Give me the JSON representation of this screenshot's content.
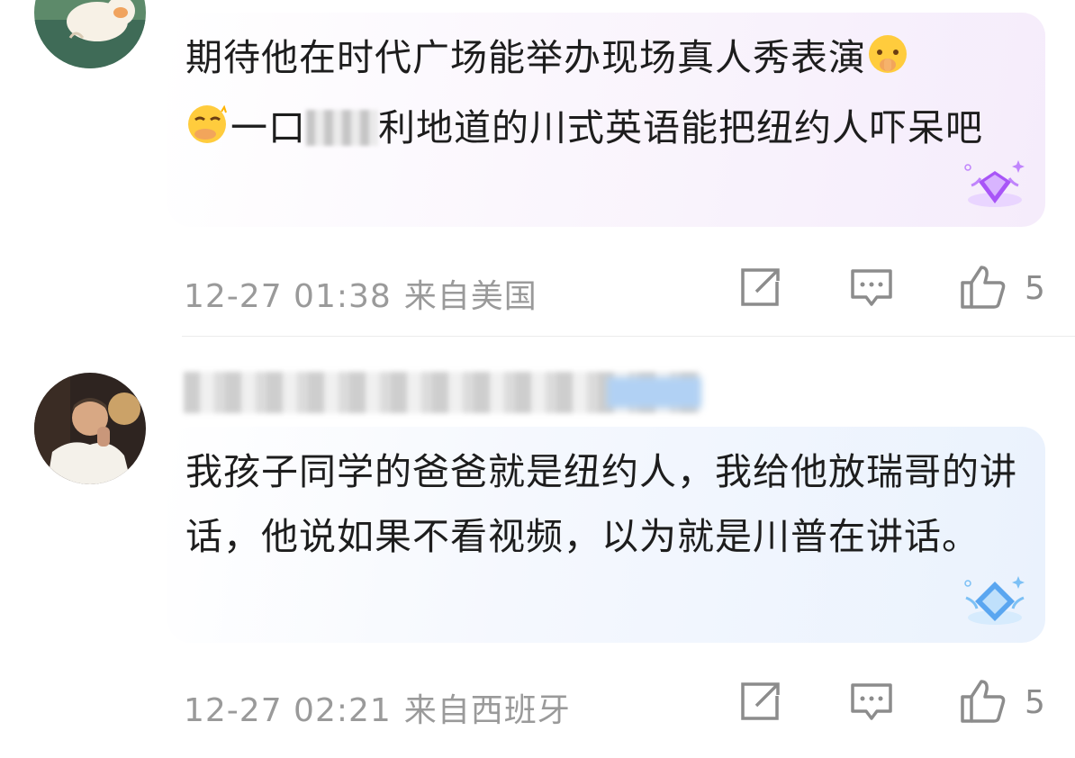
{
  "comments": [
    {
      "avatar_icon": "cat-avatar",
      "text_segments": [
        "期待他在时代广场能举办现场真人秀表演",
        "一口",
        "利地道的川式英语能把纽约人吓呆吧"
      ],
      "emoji_1": "shushing-face-emoji",
      "emoji_2": "smirk-face-emoji",
      "badge_icon": "purple-diamond-badge-icon",
      "time": "12-27 01:38",
      "location": "来自美国",
      "likes": "5"
    },
    {
      "avatar_icon": "person-avatar",
      "text": "我孩子同学的爸爸就是纽约人，我给他放瑞哥的讲话，他说如果不看视频，以为就是川普在讲话。",
      "badge_icon": "blue-diamond-badge-icon",
      "time": "12-27 02:21",
      "location": "来自西班牙",
      "likes": "5"
    }
  ],
  "icons": {
    "share": "share-icon",
    "reply": "comment-icon",
    "like": "thumbs-up-icon"
  },
  "colors": {
    "text": "#1d1d1d",
    "meta": "#9a9a9a",
    "purple_badge": "#a855f7",
    "blue_badge": "#5aa6f0"
  }
}
